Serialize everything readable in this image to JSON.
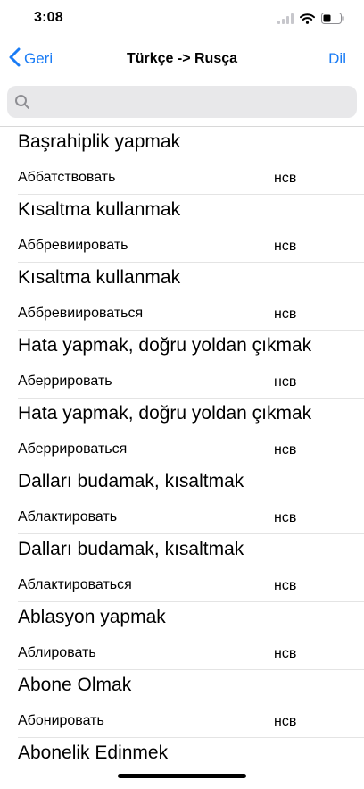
{
  "status_bar": {
    "time": "3:08"
  },
  "nav": {
    "back_label": "Geri",
    "title": "Türkçe -> Rusça",
    "lang_label": "Dil"
  },
  "search": {
    "placeholder": ""
  },
  "entries": [
    {
      "tr": "Başrahiplik yapmak",
      "ru": "Аббатствовать",
      "pos": "нсв"
    },
    {
      "tr": "Kısaltma kullanmak",
      "ru": "Аббревиировать",
      "pos": "нсв"
    },
    {
      "tr": "Kısaltma kullanmak",
      "ru": "Аббревиироваться",
      "pos": "нсв"
    },
    {
      "tr": "Hata yapmak, doğru yoldan çıkmak",
      "ru": "Аберрировать",
      "pos": "нсв"
    },
    {
      "tr": "Hata yapmak, doğru yoldan çıkmak",
      "ru": "Аберрироваться",
      "pos": "нсв"
    },
    {
      "tr": "Dalları budamak, kısaltmak",
      "ru": "Аблактировать",
      "pos": "нсв"
    },
    {
      "tr": "Dalları budamak, kısaltmak",
      "ru": "Аблактироваться",
      "pos": "нсв"
    },
    {
      "tr": "Ablasyon yapmak",
      "ru": "Аблировать",
      "pos": "нсв"
    },
    {
      "tr": "Abone Olmak",
      "ru": "Абонировать",
      "pos": "нсв"
    },
    {
      "tr": "Abonelik Edinmek",
      "ru": "",
      "pos": ""
    }
  ],
  "colors": {
    "accent": "#1a7cf5",
    "search_bg": "#e8e8ea"
  },
  "icons": [
    "chevron-left-icon",
    "search-icon",
    "signal-icon",
    "wifi-icon",
    "battery-icon"
  ]
}
